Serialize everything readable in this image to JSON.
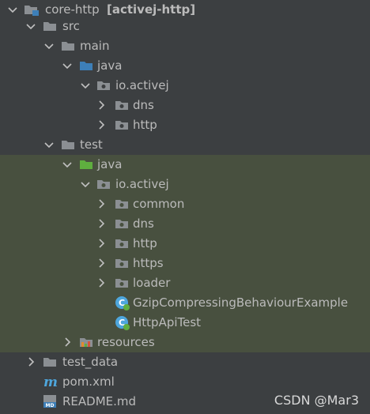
{
  "project": {
    "name": "core-http",
    "module": "[activej-http]"
  },
  "tree": {
    "src": "src",
    "main": "main",
    "main_java": "java",
    "main_pkg": "io.activej",
    "main_dns": "dns",
    "main_http": "http",
    "test": "test",
    "test_java": "java",
    "test_pkg": "io.activej",
    "test_common": "common",
    "test_dns": "dns",
    "test_http": "http",
    "test_https": "https",
    "test_loader": "loader",
    "class_gzip": "GzipCompressingBehaviourExample",
    "class_httpapi": "HttpApiTest",
    "resources": "resources",
    "test_data": "test_data",
    "pom": "pom.xml",
    "readme": "README.md"
  },
  "watermark": "CSDN @Mar3",
  "icons": {
    "expanded": "chevron-down-icon",
    "collapsed": "chevron-right-icon",
    "folder": "folder-icon",
    "source_root": "source-root-folder-icon",
    "test_root": "test-root-folder-icon",
    "package": "package-icon",
    "module": "module-folder-icon",
    "class": "java-class-icon",
    "maven": "maven-icon",
    "markdown": "markdown-icon",
    "resources": "resources-folder-icon"
  },
  "colors": {
    "background": "#3c3f41",
    "test_highlight": "#48503f",
    "text": "#bbbbbb",
    "folder": "#8b8f93",
    "source_folder": "#3d7fb8",
    "test_folder": "#5fae3f",
    "class": "#4ea6dc"
  }
}
